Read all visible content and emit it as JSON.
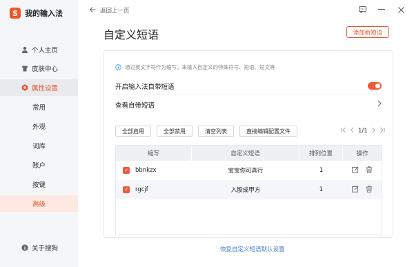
{
  "app": {
    "name": "我的输入法",
    "logo_glyph": "S",
    "accent": "#e8542b"
  },
  "sidebar": {
    "items": [
      {
        "label": "个人主页",
        "icon": "user-icon"
      },
      {
        "label": "皮肤中心",
        "icon": "tshirt-icon"
      },
      {
        "label": "属性设置",
        "icon": "hexagon-settings-icon"
      }
    ],
    "sub_items": [
      "常用",
      "外观",
      "词库",
      "账户",
      "按键",
      "高级"
    ],
    "selected_sub": "高级",
    "footer": {
      "label": "关于搜狗",
      "icon": "info-icon"
    }
  },
  "topbar": {
    "back_label": "返回上一页"
  },
  "page": {
    "title": "自定义短语",
    "add_button": "添加新短语",
    "hint": "通过英文字符作为缩写，来输入自定义的特殊符号、短语、短文等",
    "enable_label": "开启输入法自带短语",
    "enable_on": true,
    "view_label": "查看自带短语",
    "buttons": [
      "全部启用",
      "全部禁用",
      "清空列表",
      "直接编辑配置文件"
    ],
    "pager": {
      "text": "1/1"
    },
    "table": {
      "headers": [
        "缩写",
        "自定义短语",
        "排列位置",
        "操作"
      ],
      "rows": [
        {
          "abbr": "bbnkzx",
          "phrase": "宝宝你可真行",
          "position": "1",
          "checked": true
        },
        {
          "abbr": "rgcjf",
          "phrase": "入股成甲方",
          "position": "1",
          "checked": true
        }
      ]
    },
    "restore_link": "恢复自定义短语默认设置"
  }
}
